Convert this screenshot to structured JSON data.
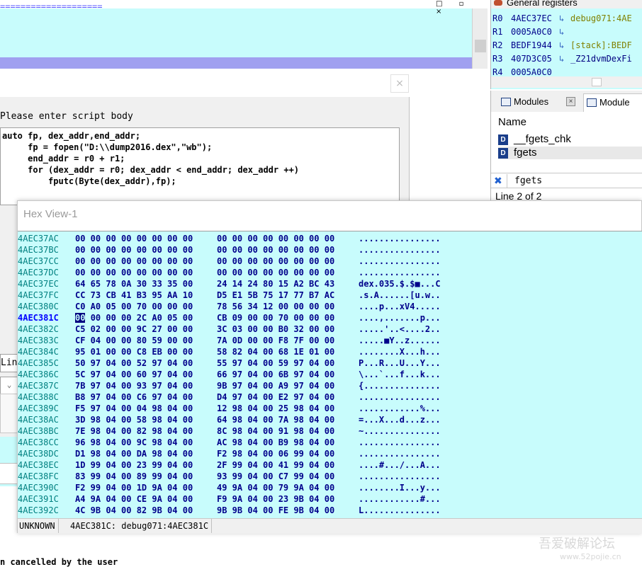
{
  "ida_view": {
    "separator": "====================",
    "window_buttons": "□ ▫ ×"
  },
  "registers": {
    "title": "General registers",
    "rows": [
      {
        "reg": "R0",
        "value": "4AEC37EC",
        "desc": "debug071:4AE"
      },
      {
        "reg": "R1",
        "value": "0005A0C0",
        "desc": ""
      },
      {
        "reg": "R2",
        "value": "BEDF1944",
        "desc": "[stack]:BEDF"
      },
      {
        "reg": "R3",
        "value": "407D3C05",
        "desc": "_Z21dvmDexFi"
      },
      {
        "reg": "R4",
        "value": "0005A0C0",
        "desc": ""
      }
    ]
  },
  "modules": {
    "tab1_label": "Modules",
    "tab2_label": "Module",
    "column_header": "Name",
    "items": [
      "__fgets_chk",
      "fgets"
    ],
    "filter_value": "fgets",
    "status": "Line 2 of 2"
  },
  "script_dialog": {
    "close_label": "×",
    "prompt_label": "Please enter script body",
    "code_lines": [
      "auto fp, dex_addr,end_addr;",
      "     fp = fopen(\"D:\\\\dump2016.dex\",\"wb\");",
      "     end_addr = r0 + r1;",
      "     for (dex_addr = r0; dex_addr < end_addr; dex_addr ++)",
      "         fputc(Byte(dex_addr),fp);"
    ],
    "side_line_label": "Line",
    "side_box_label": "⌄"
  },
  "hex_view": {
    "title": "Hex View-1",
    "rows": [
      {
        "addr": "4AEC37AC",
        "b1": "00 00 00 00 00 00 00 00",
        "b2": "00 00 00 00 00 00 00 00",
        "ascii": "................"
      },
      {
        "addr": "4AEC37BC",
        "b1": "00 00 00 00 00 00 00 00",
        "b2": "00 00 00 00 00 00 00 00",
        "ascii": "................"
      },
      {
        "addr": "4AEC37CC",
        "b1": "00 00 00 00 00 00 00 00",
        "b2": "00 00 00 00 00 00 00 00",
        "ascii": "................"
      },
      {
        "addr": "4AEC37DC",
        "b1": "00 00 00 00 00 00 00 00",
        "b2": "00 00 00 00 00 00 00 00",
        "ascii": "................"
      },
      {
        "addr": "4AEC37EC",
        "b1": "64 65 78 0A 30 33 35 00",
        "b2": "24 14 24 80 15 A2 BC 43",
        "ascii": "dex.035.$.$■...C"
      },
      {
        "addr": "4AEC37FC",
        "b1": "CC 73 CB 41 B3 95 AA 10",
        "b2": "D5 E1 5B 75 17 77 B7 AC",
        "ascii": ".s.A......[u.w.."
      },
      {
        "addr": "4AEC380C",
        "b1": "C0 A0 05 00 70 00 00 00",
        "b2": "78 56 34 12 00 00 00 00",
        "ascii": "....p...xV4....."
      },
      {
        "addr": "4AEC381C",
        "b1": "00 00 00 2C A0 05 00",
        "b2": "CB 09 00 00 70 00 00 00",
        "ascii": "....,.......p...",
        "cursor": "00",
        "highlight": true
      },
      {
        "addr": "4AEC382C",
        "b1": "C5 02 00 00 9C 27 00 00",
        "b2": "3C 03 00 00 B0 32 00 00",
        "ascii": ".....'..<....2.."
      },
      {
        "addr": "4AEC383C",
        "b1": "CF 04 00 00 80 59 00 00",
        "b2": "7A 0D 00 00 F8 7F 00 00",
        "ascii": ".....■Y..z......"
      },
      {
        "addr": "4AEC384C",
        "b1": "95 01 00 00 C8 EB 00 00",
        "b2": "58 82 04 00 68 1E 01 00",
        "ascii": "........X...h..."
      },
      {
        "addr": "4AEC385C",
        "b1": "50 97 04 00 52 97 04 00",
        "b2": "55 97 04 00 59 97 04 00",
        "ascii": "P...R...U...Y..."
      },
      {
        "addr": "4AEC386C",
        "b1": "5C 97 04 00 60 97 04 00",
        "b2": "66 97 04 00 6B 97 04 00",
        "ascii": "\\...`...f...k..."
      },
      {
        "addr": "4AEC387C",
        "b1": "7B 97 04 00 93 97 04 00",
        "b2": "9B 97 04 00 A9 97 04 00",
        "ascii": "{..............."
      },
      {
        "addr": "4AEC388C",
        "b1": "B8 97 04 00 C6 97 04 00",
        "b2": "D4 97 04 00 E2 97 04 00",
        "ascii": "................"
      },
      {
        "addr": "4AEC389C",
        "b1": "F5 97 04 00 04 98 04 00",
        "b2": "12 98 04 00 25 98 04 00",
        "ascii": "............%..."
      },
      {
        "addr": "4AEC38AC",
        "b1": "3D 98 04 00 58 98 04 00",
        "b2": "64 98 04 00 7A 98 04 00",
        "ascii": "=...X...d...z..."
      },
      {
        "addr": "4AEC38BC",
        "b1": "7E 98 04 00 82 98 04 00",
        "b2": "8C 98 04 00 91 98 04 00",
        "ascii": "~..............."
      },
      {
        "addr": "4AEC38CC",
        "b1": "96 98 04 00 9C 98 04 00",
        "b2": "AC 98 04 00 B9 98 04 00",
        "ascii": "................"
      },
      {
        "addr": "4AEC38DC",
        "b1": "D1 98 04 00 DA 98 04 00",
        "b2": "F2 98 04 00 06 99 04 00",
        "ascii": "................"
      },
      {
        "addr": "4AEC38EC",
        "b1": "1D 99 04 00 23 99 04 00",
        "b2": "2F 99 04 00 41 99 04 00",
        "ascii": "....#.../...A..."
      },
      {
        "addr": "4AEC38FC",
        "b1": "83 99 04 00 89 99 04 00",
        "b2": "93 99 04 00 C7 99 04 00",
        "ascii": "................"
      },
      {
        "addr": "4AEC390C",
        "b1": "F2 99 04 00 1D 9A 04 00",
        "b2": "49 9A 04 00 79 9A 04 00",
        "ascii": "........I...y..."
      },
      {
        "addr": "4AEC391C",
        "b1": "A4 9A 04 00 CE 9A 04 00",
        "b2": "F9 9A 04 00 23 9B 04 00",
        "ascii": "............#..."
      },
      {
        "addr": "4AEC392C",
        "b1": "4C 9B 04 00 82 9B 04 00",
        "b2": "9B 9B 04 00 FE 9B 04 00",
        "ascii": "L..............."
      }
    ],
    "status_left": "UNKNOWN",
    "status_addr": "4AEC381C: debug071:4AEC381C"
  },
  "output": {
    "message": "n cancelled by the user"
  },
  "watermark": {
    "line1": "吾爱破解论坛",
    "line2": "www.52pojie.cn"
  },
  "colors": {
    "ida_bg": "#c8fcfc",
    "hex_text": "#00008b",
    "addr_text": "#008080"
  }
}
